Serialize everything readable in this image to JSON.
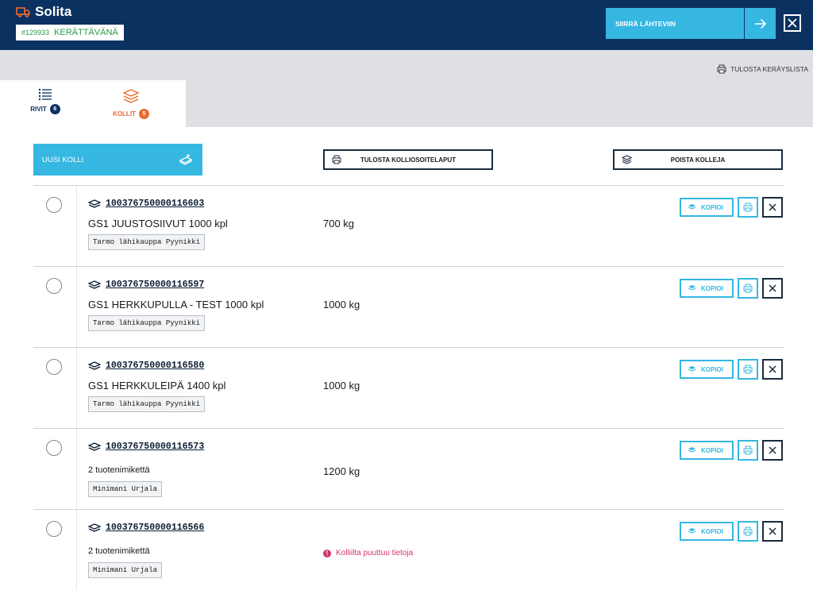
{
  "header": {
    "brand": "Solita",
    "order_number": "#129933",
    "order_status": "KERÄTTÄVÄNÄ",
    "move_label": "SIIRRÄ LÄHTEVIIN"
  },
  "toolbar": {
    "print_list_label": "TULOSTA KERÄYSLISTA"
  },
  "tabs": [
    {
      "label": "RIVIT",
      "count": "6"
    },
    {
      "label": "KOLLIT",
      "count": "5"
    }
  ],
  "actions": {
    "new_label": "UUSI KOLLI",
    "print_labels": "TULOSTA KOLLIOSOITELAPUT",
    "delete_label": "POISTA KOLLEJA"
  },
  "rows": [
    {
      "code": "100376750000116603",
      "product": "GS1 JUUSTOSIIVUT 1000 kpl",
      "tag": "Tarmo lähikauppa Pyynikki",
      "weight": "700 kg",
      "copy": "KOPIOI"
    },
    {
      "code": "100376750000116597",
      "product": "GS1 HERKKUPULLA - TEST 1000 kpl",
      "tag": "Tarmo lähikauppa Pyynikki",
      "weight": "1000 kg",
      "copy": "KOPIOI"
    },
    {
      "code": "100376750000116580",
      "product": "GS1 HERKKULEIPÄ 1400 kpl",
      "tag": "Tarmo lähikauppa Pyynikki",
      "weight": "1000 kg",
      "copy": "KOPIOI"
    },
    {
      "code": "100376750000116573",
      "product": "2 tuotenimikettä",
      "tag": "Minimani Urjala",
      "weight": "1200 kg",
      "copy": "KOPIOI"
    },
    {
      "code": "100376750000116566",
      "product": "2 tuotenimikettä",
      "tag": "Minimani Urjala",
      "warning": "Kolliilta puuttuu tietoja",
      "copy": "KOPIOI"
    }
  ],
  "colors": {
    "header_bg": "#0b3161",
    "accent": "#35b7e2",
    "active_tab": "#e86b2f",
    "status_green": "#2a9a46",
    "warning": "#d4336f"
  }
}
